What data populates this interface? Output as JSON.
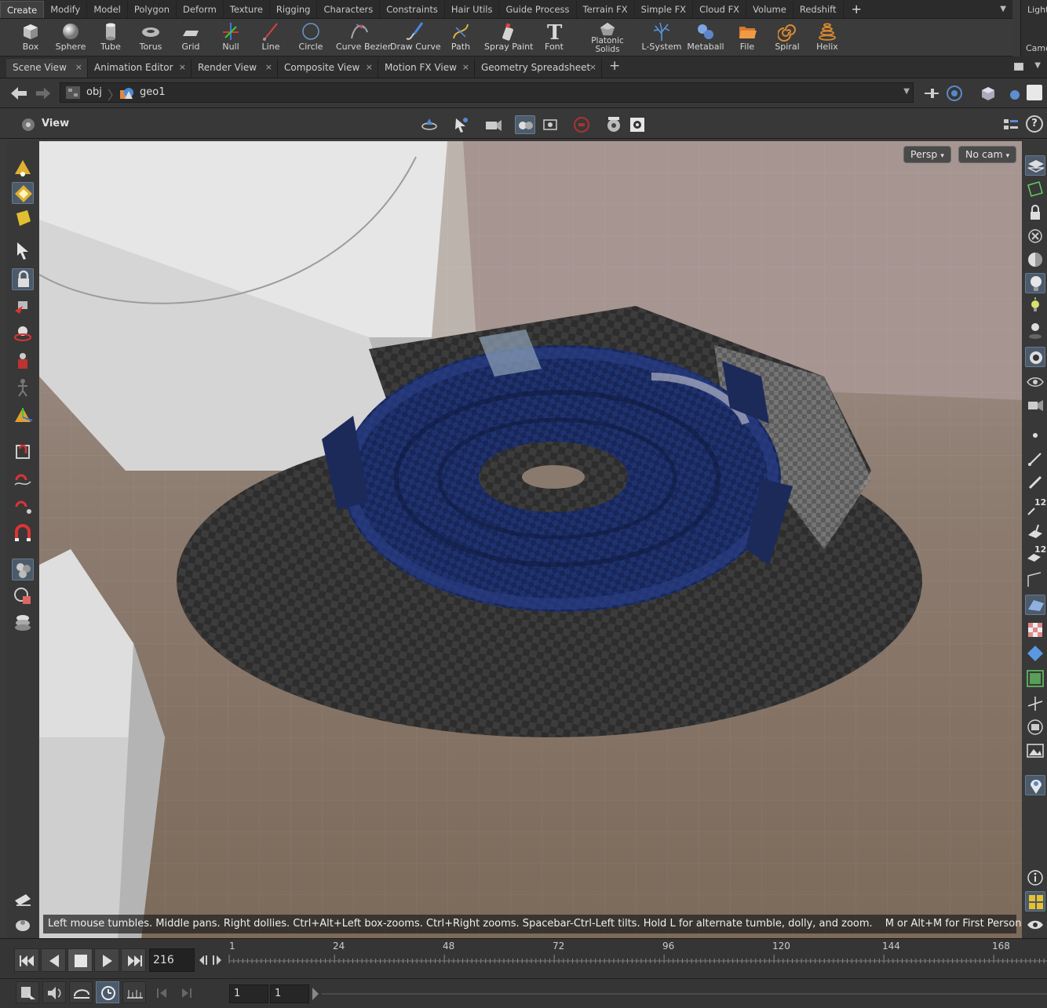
{
  "shelf": {
    "tabs": [
      "Create",
      "Modify",
      "Model",
      "Polygon",
      "Deform",
      "Texture",
      "Rigging",
      "Characters",
      "Constraints",
      "Hair Utils",
      "Guide Process",
      "Terrain FX",
      "Simple FX",
      "Cloud FX",
      "Volume",
      "Redshift"
    ],
    "active_tab": "Create",
    "add": "+",
    "menu": "▼",
    "tools": [
      "Box",
      "Sphere",
      "Tube",
      "Torus",
      "Grid",
      "Null",
      "Line",
      "Circle",
      "Curve Bezier",
      "Draw Curve",
      "Path",
      "Spray Paint",
      "Font",
      "Platonic Solids",
      "L-System",
      "Metaball",
      "File",
      "Spiral",
      "Helix"
    ],
    "platonic_1": "Platonic",
    "platonic_2": "Solids",
    "right_tab": "Light",
    "right_label": "Came"
  },
  "panes": {
    "tabs": [
      "Scene View",
      "Animation Editor",
      "Render View",
      "Composite View",
      "Motion FX View",
      "Geometry Spreadsheet"
    ],
    "close": "×",
    "add": "+"
  },
  "path": {
    "obj": "obj",
    "geo": "geo1"
  },
  "viewer": {
    "title": "View",
    "help": "?"
  },
  "viewport": {
    "persp": "Persp",
    "cam": "No cam",
    "status_1": "Left mouse tumbles. Middle pans. Right dollies. Ctrl+Alt+Left box-zooms. Ctrl+Right zooms. Spacebar-Ctrl-Left tilts. Hold L for alternate tumble, dolly, and zoom.",
    "status_2": "M or Alt+M for First Person Navigation.",
    "right_badge": "12",
    "right_badge2": "12"
  },
  "timeline": {
    "current_frame": "216",
    "ticks": [
      "1",
      "24",
      "48",
      "72",
      "96",
      "120",
      "144",
      "168"
    ],
    "range_start": "1",
    "range_end": "1"
  },
  "colors": {
    "accent": "#66798c",
    "swirl": "#1c2d63",
    "disk": "#3a3a3a"
  }
}
